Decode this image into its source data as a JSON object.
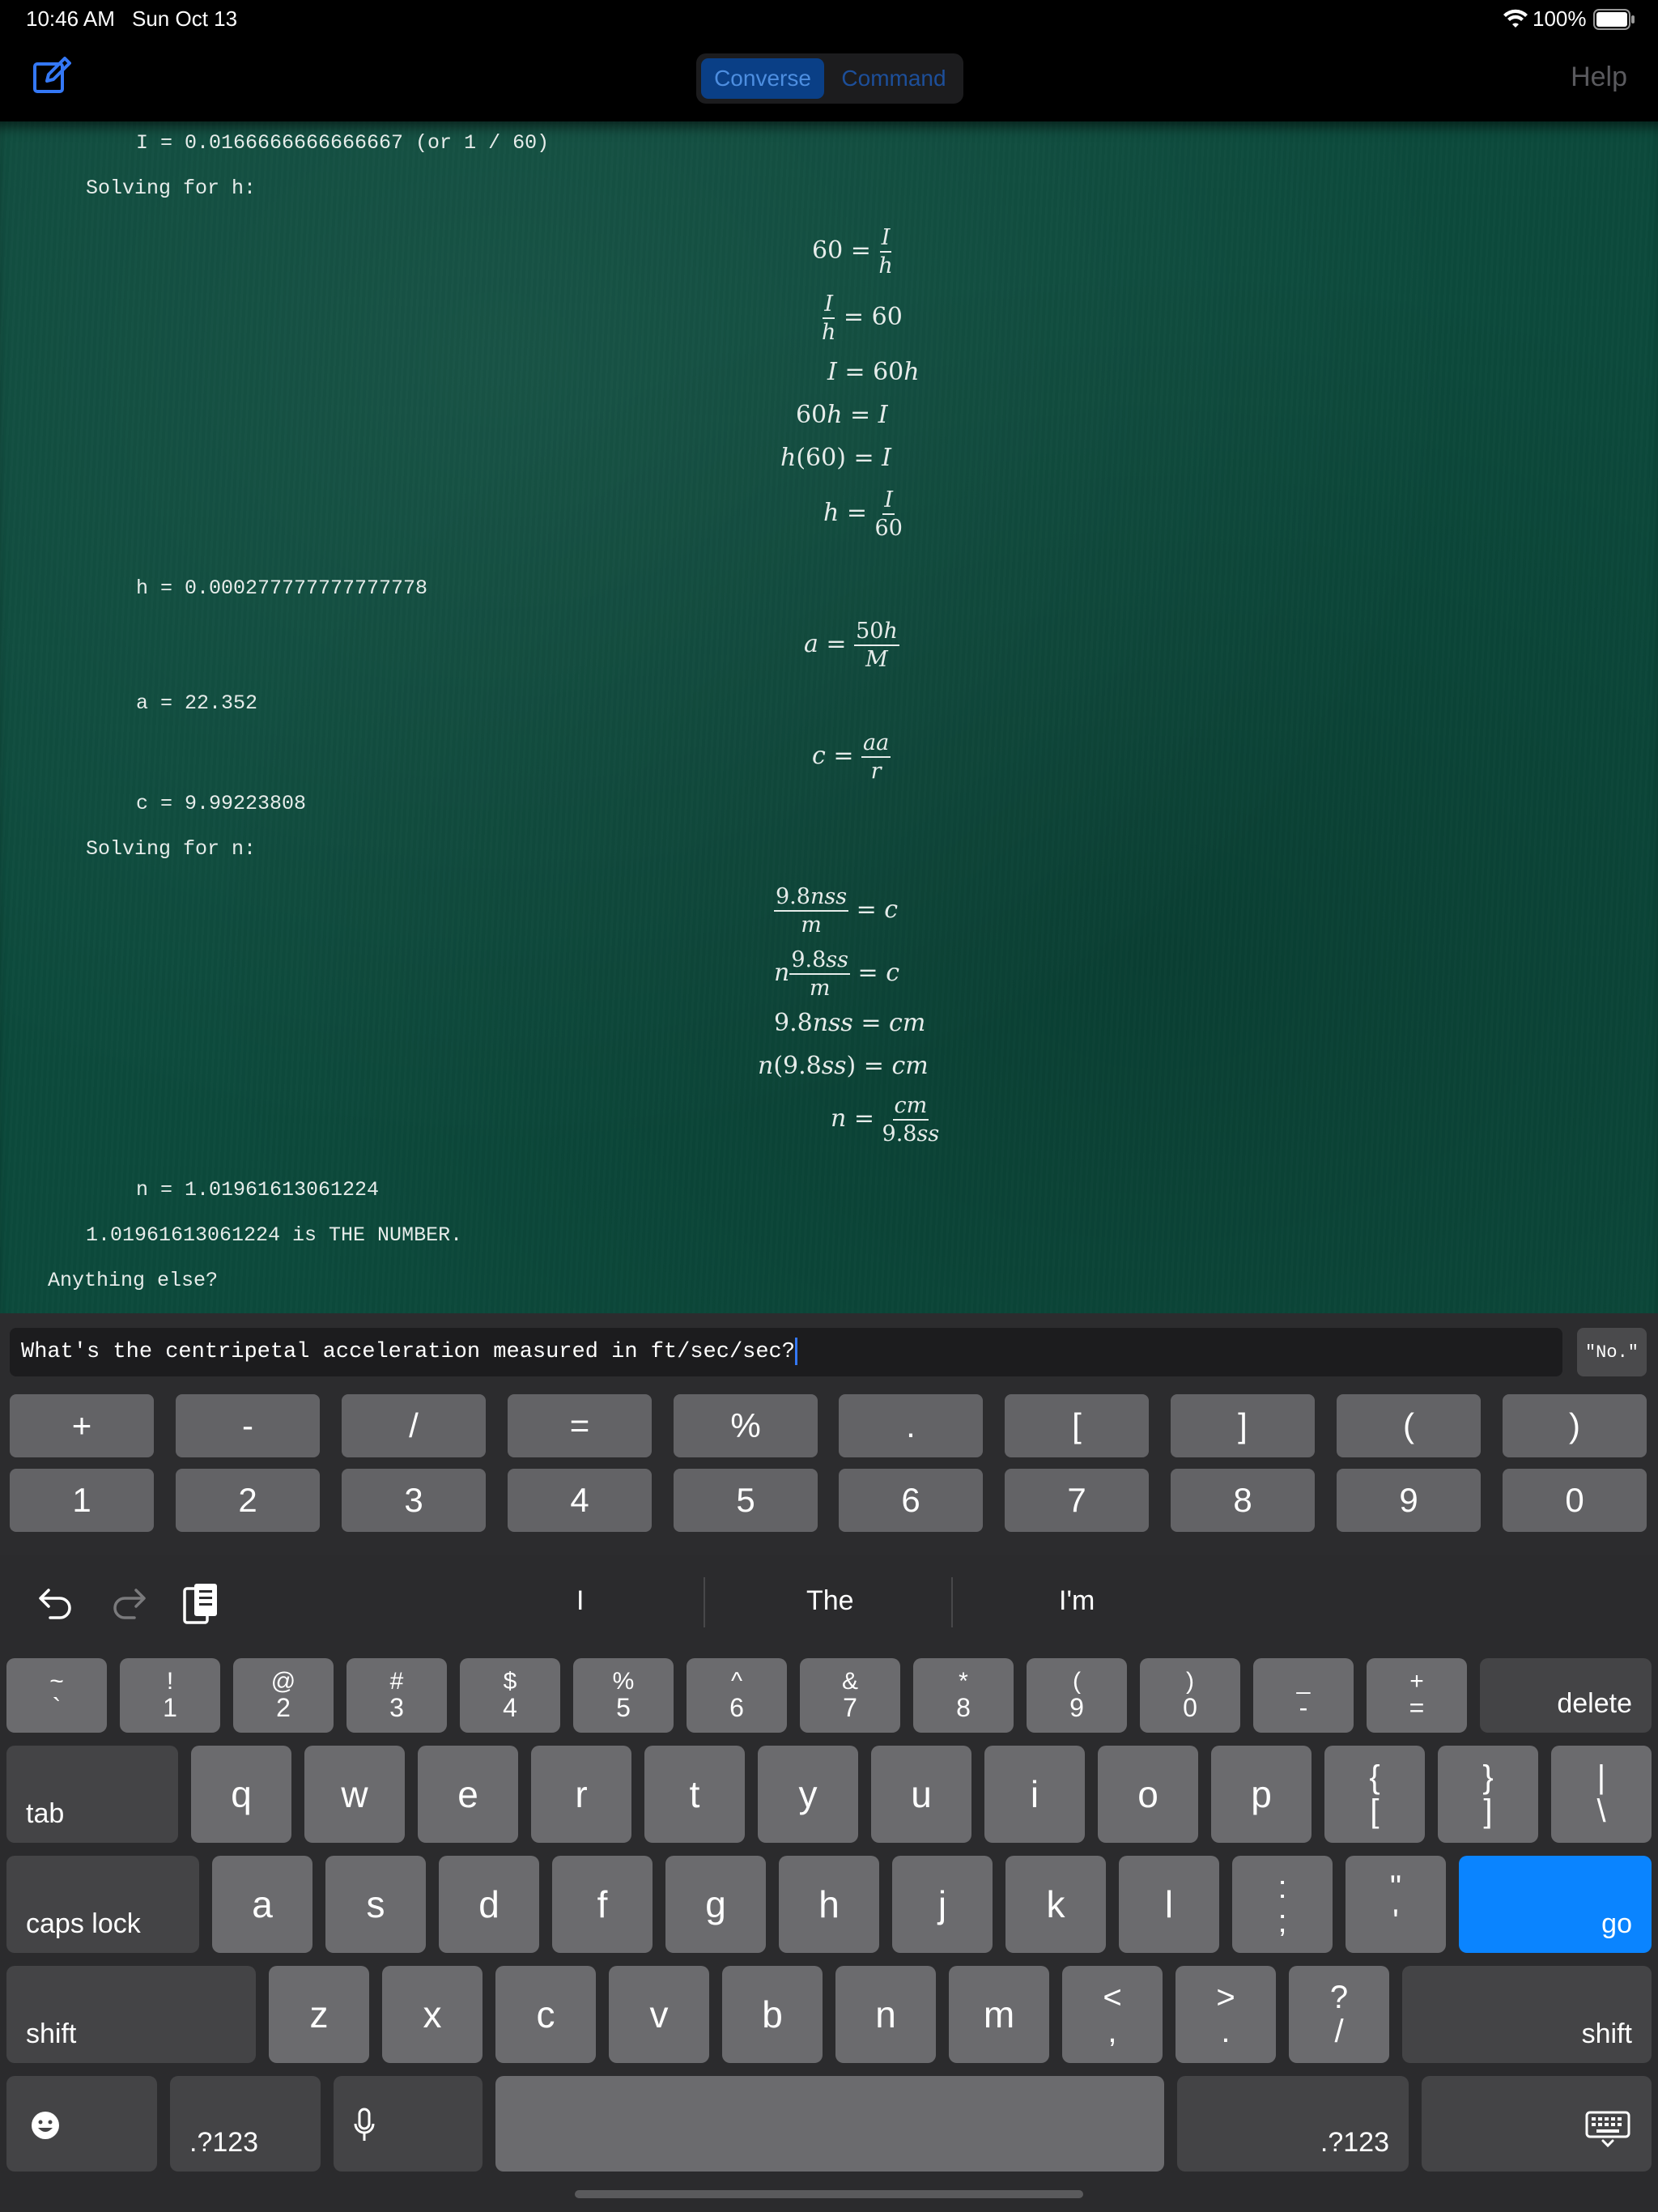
{
  "status_bar": {
    "time": "10:46 AM",
    "date": "Sun Oct 13",
    "battery": "100%"
  },
  "nav": {
    "segments": [
      "Converse",
      "Command"
    ],
    "active_segment": "Converse",
    "help_label": "Help",
    "accent_color": "#3478f6"
  },
  "transcript": {
    "lines": [
      "I = 0.0166666666666667 (or 1 / 60)",
      "Solving for h:",
      "h = 0.000277777777777778",
      "a = 22.352",
      "c = 9.99223808",
      "Solving for n:",
      "n = 1.01961613061224",
      "1.01961613061224 is THE NUMBER.",
      "Anything else?"
    ]
  },
  "input": {
    "value": "What's the centripetal acceleration measured in ft/sec/sec?",
    "quick_reply": "\"No.\""
  },
  "custom_keys": {
    "operators": [
      "+",
      "-",
      "/",
      "=",
      "%",
      ".",
      "[",
      "]",
      "(",
      ")"
    ],
    "digits": [
      "1",
      "2",
      "3",
      "4",
      "5",
      "6",
      "7",
      "8",
      "9",
      "0"
    ]
  },
  "keyboard": {
    "suggestions": [
      "I",
      "The",
      "I'm"
    ],
    "number_row": [
      [
        "~",
        "`"
      ],
      [
        "!",
        "1"
      ],
      [
        "@",
        "2"
      ],
      [
        "#",
        "3"
      ],
      [
        "$",
        "4"
      ],
      [
        "%",
        "5"
      ],
      [
        "^",
        "6"
      ],
      [
        "&",
        "7"
      ],
      [
        "*",
        "8"
      ],
      [
        "(",
        "9"
      ],
      [
        ")",
        "0"
      ],
      [
        "_",
        "-"
      ],
      [
        "+",
        "="
      ]
    ],
    "row_q": [
      "q",
      "w",
      "e",
      "r",
      "t",
      "y",
      "u",
      "i",
      "o",
      "p"
    ],
    "row_q_extra": [
      [
        "{",
        "["
      ],
      [
        "}",
        "]"
      ],
      [
        "|",
        "\\"
      ]
    ],
    "row_a": [
      "a",
      "s",
      "d",
      "f",
      "g",
      "h",
      "j",
      "k",
      "l"
    ],
    "row_a_extra": [
      [
        ":",
        ";"
      ],
      [
        "\"",
        "'"
      ]
    ],
    "row_z": [
      "z",
      "x",
      "c",
      "v",
      "b",
      "n",
      "m"
    ],
    "row_z_extra": [
      [
        "<",
        ","
      ],
      [
        ">",
        "."
      ],
      [
        "?",
        "/"
      ]
    ],
    "labels": {
      "delete": "delete",
      "tab": "tab",
      "caps": "caps lock",
      "go": "go",
      "shift": "shift",
      "numbers": ".?123"
    }
  }
}
